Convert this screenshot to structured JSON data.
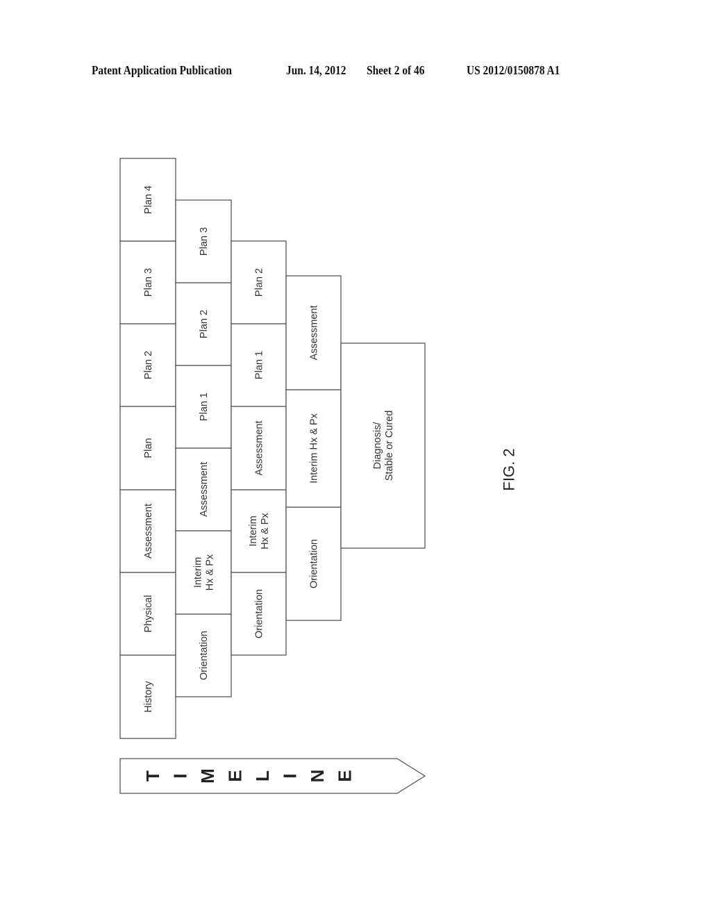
{
  "header": {
    "publication": "Patent Application Publication",
    "date": "Jun. 14, 2012",
    "sheet": "Sheet 2 of 46",
    "patent_number": "US 2012/0150878 A1"
  },
  "figure": {
    "label": "FIG. 2",
    "columns": [
      {
        "name": "visit-1",
        "boxes": [
          [
            "History"
          ],
          [
            "Physical"
          ],
          [
            "Assessment"
          ],
          [
            "Plan"
          ],
          [
            "Plan 2"
          ],
          [
            "Plan 3"
          ],
          [
            "Plan 4"
          ]
        ]
      },
      {
        "name": "visit-2",
        "boxes": [
          [
            "Orientation"
          ],
          [
            "Interim",
            "Hx & Px"
          ],
          [
            "Assessment"
          ],
          [
            "Plan 1"
          ],
          [
            "Plan 2"
          ],
          [
            "Plan 3"
          ]
        ]
      },
      {
        "name": "visit-3",
        "boxes": [
          [
            "Orientation"
          ],
          [
            "Interim",
            "Hx & Px"
          ],
          [
            "Assessment"
          ],
          [
            "Plan 1"
          ],
          [
            "Plan 2"
          ]
        ]
      },
      {
        "name": "visit-4",
        "boxes": [
          [
            "Orientation"
          ],
          [
            "Interim Hx & Px"
          ],
          [
            "Assessment"
          ]
        ]
      },
      {
        "name": "visit-5",
        "boxes": [
          [
            "Diagnosis/",
            "Stable or Cured"
          ]
        ]
      }
    ],
    "timeline": {
      "label": "TIMELINE",
      "letters": [
        "T",
        "I",
        "M",
        "E",
        "L",
        "I",
        "N",
        "E"
      ]
    }
  }
}
